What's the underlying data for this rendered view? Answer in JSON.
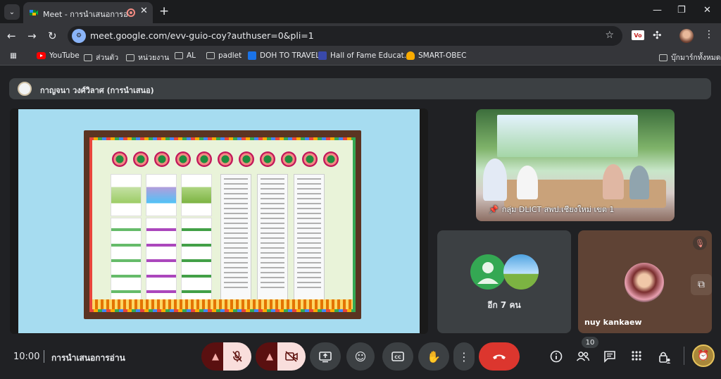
{
  "browser": {
    "tab_title": "Meet - การนำเสนอการอ่าน",
    "tab_close": "✕",
    "new_tab": "+",
    "tab_search": "⌄",
    "window_controls": [
      "—",
      "❐",
      "✕"
    ],
    "url": "meet.google.com/evv-guio-coy?authuser=0&pli=1",
    "nav": {
      "back": "←",
      "forward": "→",
      "reload": "↻"
    },
    "extension_label": "Vo",
    "bookmarks": [
      {
        "label": "YouTube",
        "icon": "youtube-icon"
      },
      {
        "label": "ส่วนตัว",
        "icon": "folder-icon"
      },
      {
        "label": "หน่วยงาน",
        "icon": "folder-icon"
      },
      {
        "label": "AL",
        "icon": "folder-icon"
      },
      {
        "label": "padlet",
        "icon": "folder-icon"
      },
      {
        "label": "DOH TO TRAVEL",
        "icon": "doh-icon"
      },
      {
        "label": "Hall of Fame Educat...",
        "icon": "hof-icon"
      },
      {
        "label": "SMART-OBEC",
        "icon": "obec-icon"
      }
    ],
    "all_bookmarks": "บุ๊กมาร์กทั้งหมด"
  },
  "meet": {
    "presenter_name": "กาญจนา วงศ์วิลาศ (การนำเสนอ)",
    "participants": {
      "group_label": "กลุ่ม DLICT สพป.เชียงใหม่ เขต 1",
      "more_label": "อีก 7 คน",
      "nuy_name": "nuy kankaew"
    },
    "controls": {
      "time": "10:00",
      "meeting_title": "การนำเสนอการอ่าน",
      "people_count": "10"
    },
    "colors": {
      "accent": "#8ab4f8",
      "end_call": "#dc362e",
      "muted_bg": "#f9dedc"
    }
  }
}
